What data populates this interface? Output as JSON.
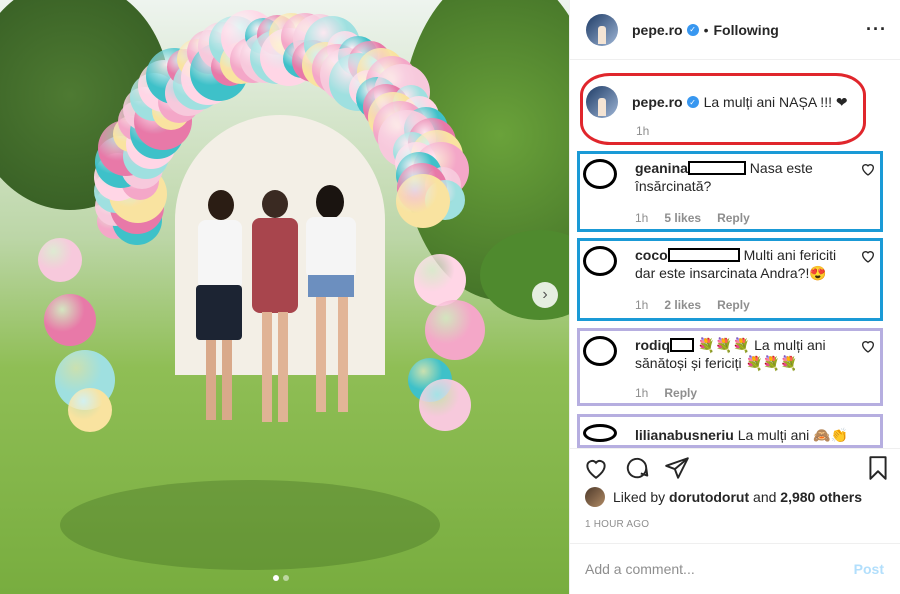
{
  "post": {
    "username": "pepe.ro",
    "follow_status": "Following",
    "more_icon": "more-horizontal-icon",
    "caption_text": "La mulți ani NAȘA !!! ❤",
    "caption_time": "1h"
  },
  "comments": [
    {
      "user": "geanina",
      "text": "Nasa este însărcinată?",
      "time": "1h",
      "likes": "5 likes",
      "reply": "Reply"
    },
    {
      "user": "coco",
      "text": "Multi ani fericiti dar este insarcinata Andra?!😍",
      "time": "1h",
      "likes": "2 likes",
      "reply": "Reply"
    },
    {
      "user": "rodiq",
      "text": "💐💐💐 La mulți ani sănătoși și fericiți 💐💐💐",
      "time": "1h",
      "reply": "Reply"
    },
    {
      "user": "lilianabusneriu",
      "text": "La mulți ani 🙈👏"
    }
  ],
  "actions": {
    "icons": [
      "heart-icon",
      "comment-icon",
      "share-icon",
      "bookmark-icon"
    ],
    "liked_by_prefix": "Liked by",
    "liked_by_user": "dorutodorut",
    "liked_by_and": "and",
    "liked_by_others": "2,980 others",
    "time_ago": "1 HOUR AGO"
  },
  "add_comment": {
    "placeholder": "Add a comment...",
    "post_label": "Post"
  },
  "colors": {
    "highlight_red": "#e0262c",
    "highlight_blue": "#1a9ad6",
    "highlight_purple": "#b6aee0",
    "verified_blue": "#3897f0",
    "post_disabled": "#b2dffc"
  }
}
